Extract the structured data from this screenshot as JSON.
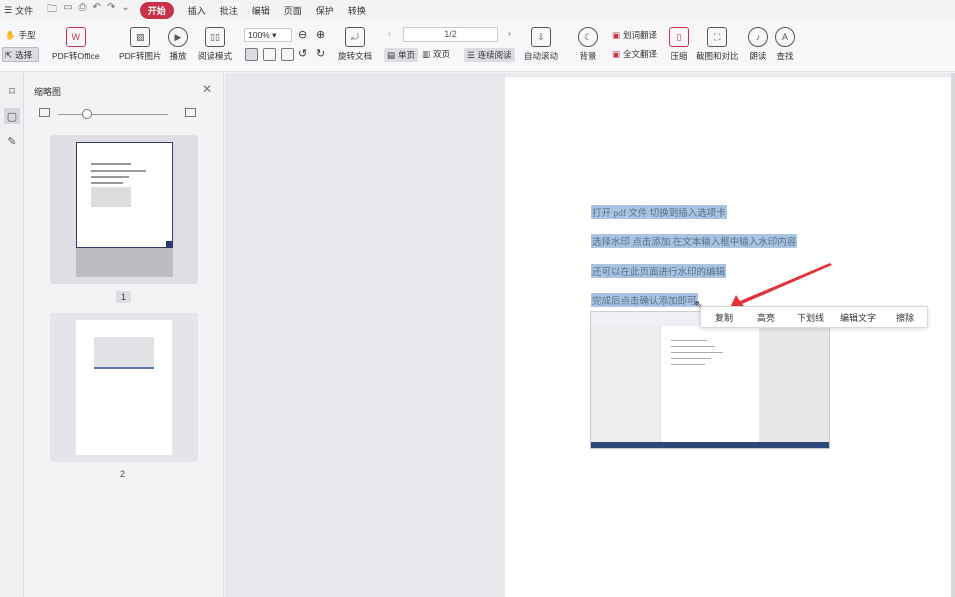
{
  "menubar": {
    "file_label": "文件",
    "tabs": [
      "开始",
      "插入",
      "批注",
      "编辑",
      "页面",
      "保护",
      "转换"
    ]
  },
  "ribbon": {
    "hand": "手型",
    "select": "选择",
    "pdf_to_office": "PDF转Office",
    "pdf_to_image": "PDF转图片",
    "play": "播放",
    "read_mode": "阅读模式",
    "zoom": "100%",
    "rotate_doc": "旋转文档",
    "page_indicator": "1/2",
    "single_page": "单页",
    "double_page": "双页",
    "continuous": "连续阅读",
    "auto_scroll": "自动滚动",
    "background": "背景",
    "word_translate": "划词翻译",
    "full_translate": "全文翻译",
    "compress": "压缩",
    "screenshot_compare": "截图和对比",
    "read_aloud": "朗读",
    "find": "查找"
  },
  "thumbnail_panel": {
    "title": "缩略图",
    "pages": [
      "1",
      "2"
    ]
  },
  "document": {
    "lines": [
      "打开 pdf 文件   切换到插入选项卡",
      "选择水印     点击添加    在文本输入框中输入水印内容",
      "还可以在此页面进行水印的编辑",
      "完成后点击确认添加即可"
    ]
  },
  "context_menu": {
    "items": [
      "复制",
      "高亮",
      "下划线",
      "编辑文字",
      "擦除"
    ]
  },
  "colors": {
    "accent": "#c7324a",
    "highlight": "#a8c4e2",
    "arrow": "#e5323a"
  }
}
